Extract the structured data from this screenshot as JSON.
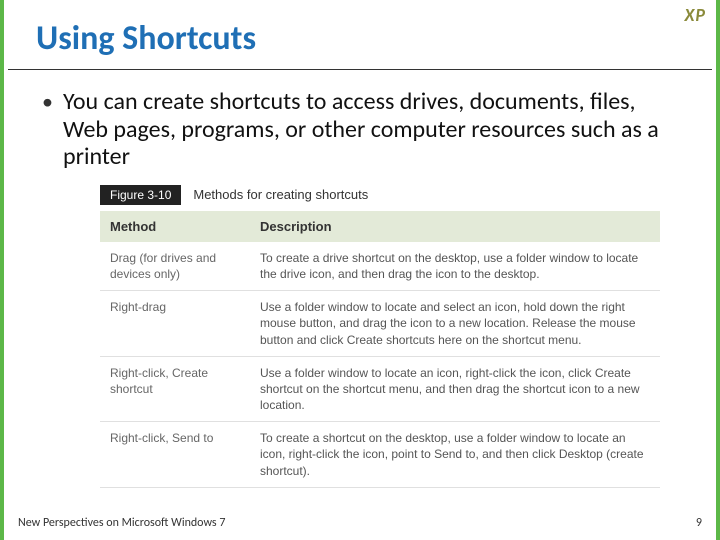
{
  "badge": "XP",
  "title": "Using Shortcuts",
  "bullet": "You can create shortcuts to access drives, documents, files, Web pages, programs, or other computer resources such as a printer",
  "figure": {
    "label": "Figure 3-10",
    "caption": "Methods for creating shortcuts",
    "headers": {
      "method": "Method",
      "description": "Description"
    },
    "rows": [
      {
        "method": "Drag (for drives and devices only)",
        "description": "To create a drive shortcut on the desktop, use a folder window to locate the drive icon, and then drag the icon to the desktop."
      },
      {
        "method": "Right-drag",
        "description": "Use a folder window to locate and select an icon, hold down the right mouse button, and drag the icon to a new location. Release the mouse button and click Create shortcuts here on the shortcut menu."
      },
      {
        "method": "Right-click, Create shortcut",
        "description": "Use a folder window to locate an icon, right-click the icon, click Create shortcut on the shortcut menu, and then drag the shortcut icon to a new location."
      },
      {
        "method": "Right-click, Send to",
        "description": "To create a shortcut on the desktop, use a folder window to locate an icon, right-click the icon, point to Send to, and then click Desktop (create shortcut)."
      }
    ]
  },
  "footer": {
    "left": "New Perspectives on Microsoft Windows 7",
    "right": "9"
  }
}
